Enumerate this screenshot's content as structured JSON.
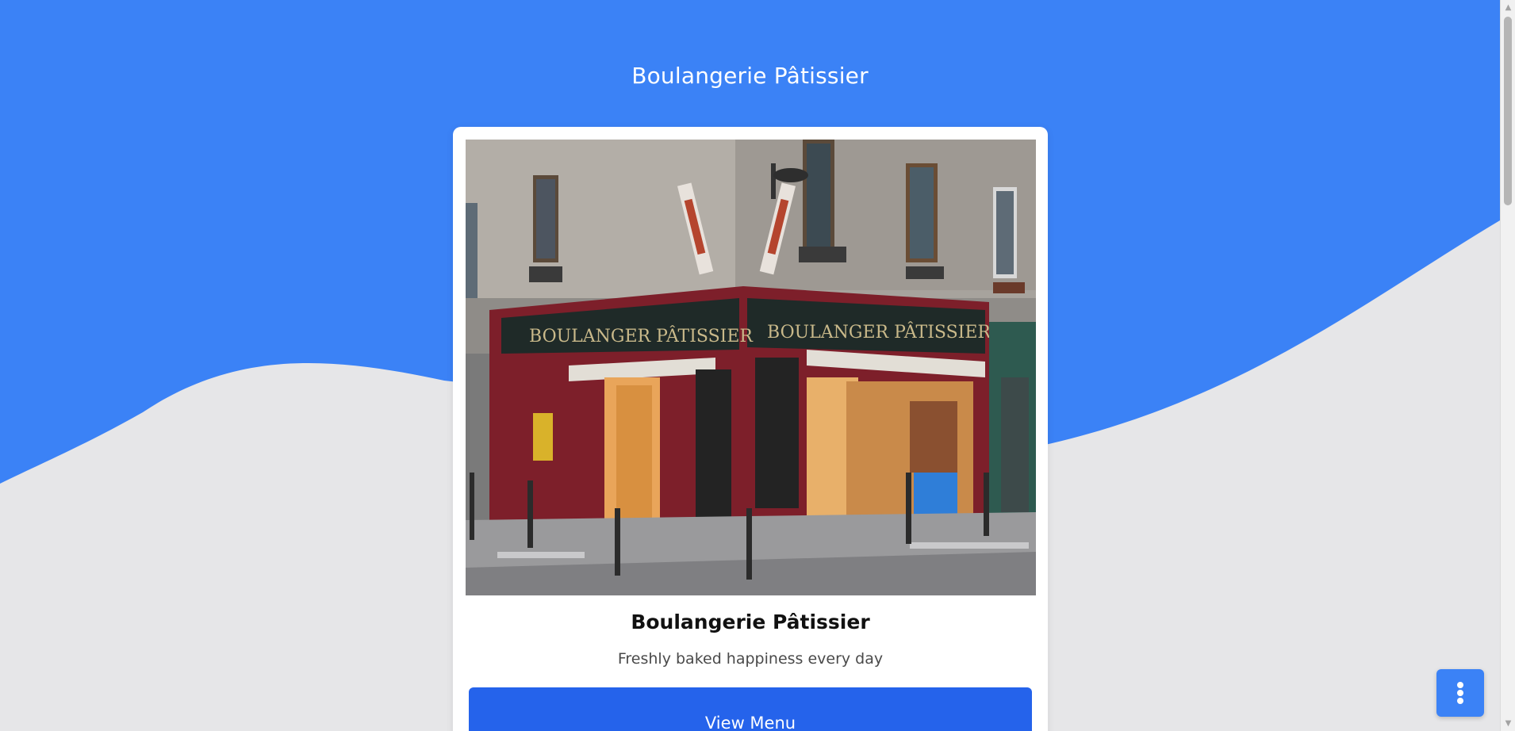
{
  "page": {
    "title": "Boulangerie Pâtissier"
  },
  "card": {
    "image_alt": "Boulangerie Pâtissier storefront",
    "shop_sign": "BOULANGER PÂTISSIER",
    "heading": "Boulangerie Pâtissier",
    "tagline": "Freshly baked happiness every day",
    "button_label": "View Menu"
  },
  "fab": {
    "icon": "more-vertical-icon"
  },
  "scrollbar": {
    "up_arrow": "▲",
    "down_arrow": "▼"
  },
  "colors": {
    "header_blue": "#3b82f6",
    "page_gray": "#e6e6e8",
    "button_blue": "#2563eb",
    "card_white": "#ffffff"
  }
}
